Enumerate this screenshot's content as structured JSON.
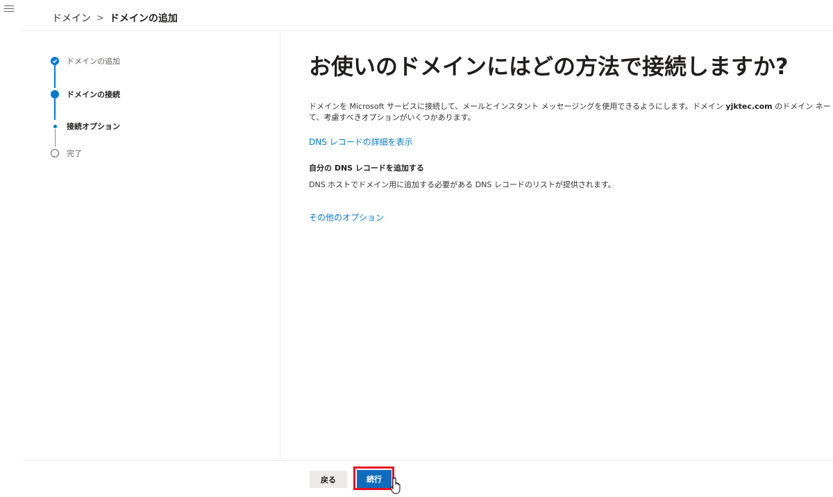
{
  "breadcrumb": {
    "parent": "ドメイン",
    "separator": ">",
    "current": "ドメインの追加"
  },
  "stepper": {
    "steps": [
      {
        "label": "ドメインの追加",
        "state": "completed"
      },
      {
        "label": "ドメインの接続",
        "state": "current"
      },
      {
        "label": "接続オプション",
        "state": "current-substep"
      },
      {
        "label": "完了",
        "state": "pending"
      }
    ]
  },
  "main": {
    "title": "お使いのドメインにはどの方法で接続しますか?",
    "description_part1": "ドメインを Microsoft サービスに接続して、メールとインスタント メッセージングを使用できるようにします。ドメイン ",
    "description_domain": "yjktec.com",
    "description_part2": " のドメイン ネー",
    "description_line2": "て、考慮すべきオプションがいくつかあります。",
    "dns_details_link": "DNS レコードの詳細を表示",
    "option_title": "自分の DNS レコードを追加する",
    "option_description": "DNS ホストでドメイン用に追加する必要がある DNS レコードのリストが提供されます。",
    "more_options_link": "その他のオプション"
  },
  "footer": {
    "back_label": "戻る",
    "next_label": "続行"
  },
  "colors": {
    "accent": "#0078d4",
    "primary_button": "#0f6cbd",
    "highlight": "#e81123"
  }
}
